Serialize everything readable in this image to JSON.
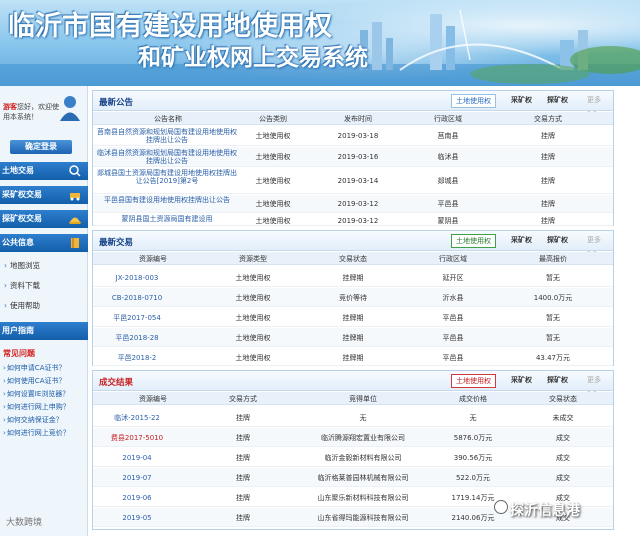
{
  "header": {
    "title_line1": "临沂市国有建设用地使用权",
    "title_line2": "和矿业权网上交易系统"
  },
  "sidebar": {
    "greet_user": "游客",
    "greet_text": "您好，欢迎使用本系统！",
    "login_button": "确定登录",
    "nav": [
      {
        "label": "土地交易"
      },
      {
        "label": "采矿权交易"
      },
      {
        "label": "探矿权交易"
      },
      {
        "label": "公共信息"
      }
    ],
    "public_items": [
      "地图浏览",
      "资料下载",
      "使用帮助"
    ],
    "guide": "用户指南",
    "faq_title": "常见问题",
    "faq_items": [
      "如何申请CA证书？",
      "如何使用CA证书？",
      "如何设置IE浏览器？",
      "如何进行网上申购？",
      "如何交纳保证金？",
      "如何进行网上竞价？"
    ]
  },
  "announcements": {
    "title": "最新公告",
    "tabs": [
      "土地使用权",
      "采矿权",
      "探矿权",
      "更多>>"
    ],
    "columns": [
      "公告名称",
      "公告类别",
      "发布时间",
      "行政区域",
      "交易方式"
    ],
    "rows": [
      {
        "name": "莒南县自然资源和规划局国有建设用地使用权挂牌出让公告",
        "category": "土地使用权",
        "date": "2019-03-18",
        "region": "莒南县",
        "mode": "挂牌"
      },
      {
        "name": "临沭县自然资源和规划局国有建设用地使用权挂牌出让公告",
        "category": "土地使用权",
        "date": "2019-03-16",
        "region": "临沭县",
        "mode": "挂牌"
      },
      {
        "name": "郯城县国土资源局国有建设用地使用权挂牌出让公告[2019]第2号",
        "category": "土地使用权",
        "date": "2019-03-14",
        "region": "郯城县",
        "mode": "挂牌"
      },
      {
        "name": "平邑县国有建设用地使用权挂牌出让公告",
        "category": "土地使用权",
        "date": "2019-03-12",
        "region": "平邑县",
        "mode": "挂牌"
      },
      {
        "name": "蒙阴县国土资源局国有建设用",
        "category": "土地使用权",
        "date": "2019-03-12",
        "region": "蒙阴县",
        "mode": "挂牌"
      }
    ]
  },
  "trades": {
    "title": "最新交易",
    "tabs": [
      "土地使用权",
      "采矿权",
      "探矿权",
      "更多>>"
    ],
    "columns": [
      "资源编号",
      "资源类型",
      "交易状态",
      "行政区域",
      "最高报价"
    ],
    "rows": [
      {
        "id": "JX-2018-003",
        "type": "土地使用权",
        "status": "挂牌期",
        "region": "延开区",
        "price": "暂无"
      },
      {
        "id": "CB-2018-0710",
        "type": "土地使用权",
        "status": "竞价等待",
        "region": "沂水县",
        "price": "1400.0万元"
      },
      {
        "id": "平邑2017-054",
        "type": "土地使用权",
        "status": "挂牌期",
        "region": "平邑县",
        "price": "暂无"
      },
      {
        "id": "平邑2018-28",
        "type": "土地使用权",
        "status": "挂牌期",
        "region": "平邑县",
        "price": "暂无"
      },
      {
        "id": "平邑2018-2",
        "type": "土地使用权",
        "status": "挂牌期",
        "region": "平邑县",
        "price": "43.47万元"
      }
    ]
  },
  "results": {
    "title": "成交结果",
    "tabs": [
      "土地使用权",
      "采矿权",
      "探矿权",
      "更多>>"
    ],
    "columns": [
      "资源编号",
      "交易方式",
      "竞得单位",
      "成交价格",
      "交易状态"
    ],
    "rows": [
      {
        "id": "临沭-2015-22",
        "mode": "挂牌",
        "winner": "无",
        "price": "无",
        "status": "未成交"
      },
      {
        "id": "费县2017-5010",
        "mode": "挂牌",
        "winner": "临沂腾源翔宏置业有限公司",
        "price": "5876.0万元",
        "status": "成交"
      },
      {
        "id": "2019-04",
        "mode": "挂牌",
        "winner": "临沂金毅新材料有限公司",
        "price": "390.56万元",
        "status": "成交"
      },
      {
        "id": "2019-07",
        "mode": "挂牌",
        "winner": "临沂格莱普园林机械有限公司",
        "price": "522.0万元",
        "status": "成交"
      },
      {
        "id": "2019-06",
        "mode": "挂牌",
        "winner": "山东聚乐新材料科技有限公司",
        "price": "1719.14万元",
        "status": "成交"
      },
      {
        "id": "2019-05",
        "mode": "挂牌",
        "winner": "山东省得玛能源科技有限公司",
        "price": "2140.06万元",
        "status": "成交"
      }
    ]
  },
  "watermarks": {
    "right": "探沂信息港",
    "left": "大数跨境"
  },
  "colors": {
    "nav_blue": "#1d64b4",
    "title_blue": "#123f86",
    "result_red": "#c62020",
    "trade_green": "#2b7f30"
  }
}
